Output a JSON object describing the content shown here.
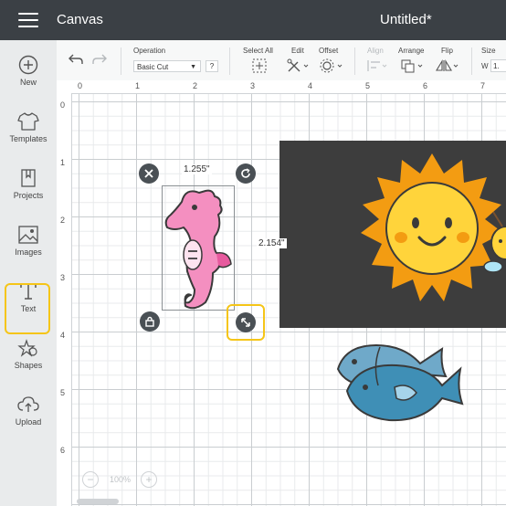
{
  "header": {
    "app_title": "Canvas",
    "doc_title": "Untitled*"
  },
  "sidebar": {
    "items": [
      {
        "label": "New",
        "icon": "plus-circle-icon"
      },
      {
        "label": "Templates",
        "icon": "shirt-icon"
      },
      {
        "label": "Projects",
        "icon": "bookmark-icon"
      },
      {
        "label": "Images",
        "icon": "image-icon"
      },
      {
        "label": "Text",
        "icon": "text-t-icon"
      },
      {
        "label": "Shapes",
        "icon": "shapes-icon"
      },
      {
        "label": "Upload",
        "icon": "cloud-upload-icon"
      }
    ],
    "highlight_color": "#f5c518"
  },
  "toolbar": {
    "operation_label": "Operation",
    "operation_value": "Basic Cut",
    "help": "?",
    "select_all": "Select All",
    "edit": "Edit",
    "offset": "Offset",
    "align": "Align",
    "arrange": "Arrange",
    "flip": "Flip",
    "size": "Size",
    "w_label": "W",
    "w_value": "1."
  },
  "ruler": {
    "top": [
      "0",
      "1",
      "2",
      "3",
      "4",
      "5",
      "6",
      "7"
    ],
    "left": [
      "0",
      "1",
      "2",
      "3",
      "4",
      "5",
      "6"
    ]
  },
  "selection": {
    "width": "1.255\"",
    "height": "2.154\""
  },
  "zoom": {
    "value": "100%",
    "minus": "−",
    "plus": "+"
  },
  "colors": {
    "topbar": "#3b4045",
    "accent": "#f5c518",
    "panel": "#3d3d3d"
  }
}
